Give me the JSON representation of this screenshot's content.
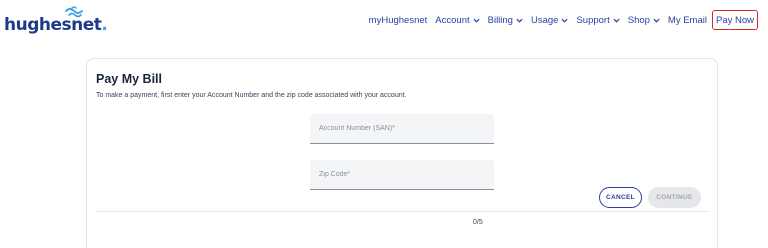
{
  "brand": {
    "logo_text_hughes": "hughes",
    "logo_text_net": "net",
    "logo_dot": ".",
    "colors": {
      "primary": "#2b3fa0",
      "logo": "#1e3a8a",
      "accent": "#3aa0e6",
      "highlight": "#d62828"
    }
  },
  "nav": {
    "items": [
      {
        "label": "myHughesnet",
        "dropdown": false
      },
      {
        "label": "Account",
        "dropdown": true
      },
      {
        "label": "Billing",
        "dropdown": true
      },
      {
        "label": "Usage",
        "dropdown": true
      },
      {
        "label": "Support",
        "dropdown": true
      },
      {
        "label": "Shop",
        "dropdown": true
      },
      {
        "label": "My Email",
        "dropdown": false
      },
      {
        "label": "Pay Now",
        "dropdown": false,
        "highlighted": true
      }
    ]
  },
  "card": {
    "title": "Pay My Bill",
    "subtitle": "To make a payment, first enter your Account Number and the zip code associated with your account.",
    "account_field": {
      "placeholder": "Account Number (SAN)*",
      "value": ""
    },
    "zip_field": {
      "placeholder": "Zip Code*",
      "value": ""
    },
    "zip_counter": "0/5",
    "cancel_label": "CANCEL",
    "continue_label": "CONTINUE"
  }
}
